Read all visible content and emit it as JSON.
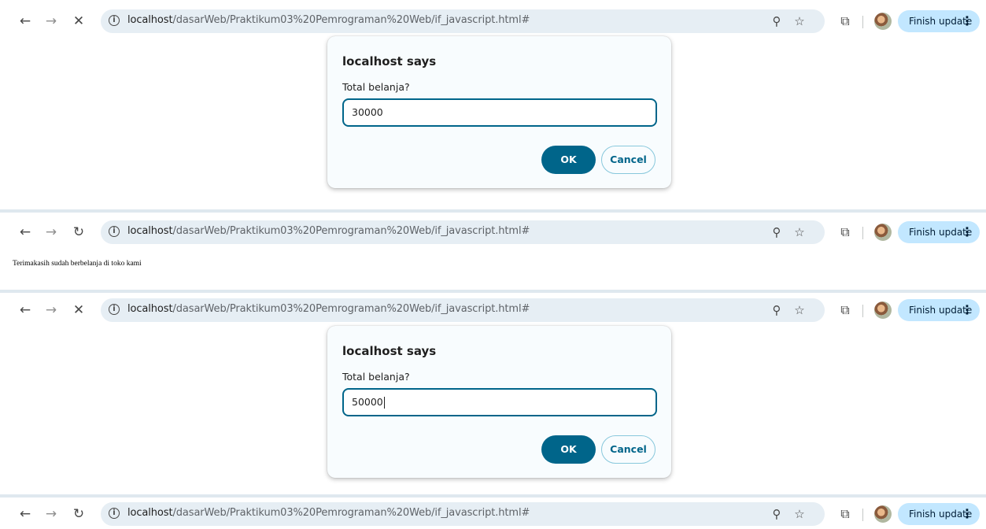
{
  "browser": {
    "url_host": "localhost",
    "url_path": "/dasarWeb/Praktikum03%20Pemrograman%20Web/if_javascript.html#",
    "update_label": "Finish update",
    "icons": {
      "back": "back-arrow-icon",
      "forward": "forward-arrow-icon",
      "stop": "close-icon",
      "reload": "reload-icon",
      "info": "info-icon",
      "zoom": "zoom-icon",
      "bookmark": "star-icon",
      "extensions": "puzzle-icon",
      "menu": "more-vert-icon"
    }
  },
  "dialogs": [
    {
      "title": "localhost says",
      "message": "Total belanja?",
      "input_value": "30000",
      "ok_label": "OK",
      "cancel_label": "Cancel"
    },
    {
      "title": "localhost says",
      "message": "Total belanja?",
      "input_value": "50000",
      "ok_label": "OK",
      "cancel_label": "Cancel"
    }
  ],
  "page": {
    "message": "Terimakasih sudah berbelanja di toko kami"
  },
  "colors": {
    "accent": "#00658a",
    "update_button_bg": "#c2e7ff",
    "omnibox_bg": "#e6eef4"
  }
}
